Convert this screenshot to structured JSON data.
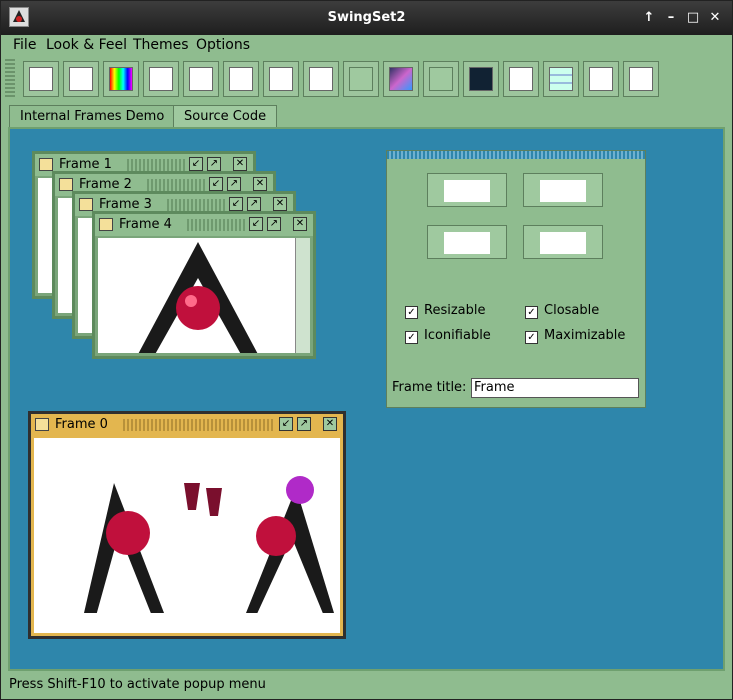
{
  "window": {
    "title": "SwingSet2"
  },
  "titlebar_buttons": [
    "↑",
    "–",
    "□",
    "✕"
  ],
  "menu": [
    {
      "label": "File"
    },
    {
      "label": "Look & Feel"
    },
    {
      "label": "Themes"
    },
    {
      "label": "Options"
    }
  ],
  "toolbar_icons": [
    "internal-frame-icon",
    "button-icon",
    "color-chooser-icon",
    "combobox-icon",
    "filechooser-icon",
    "html-icon",
    "list-icon",
    "optionpane-icon",
    "progressbar-icon",
    "scrollpane-icon",
    "slider-icon",
    "splitpane-icon",
    "tabbedpane-icon",
    "table-icon",
    "tooltip-icon",
    "tree-icon"
  ],
  "tabs": [
    {
      "label": "Internal Frames Demo",
      "active": true
    },
    {
      "label": "Source Code",
      "active": false
    }
  ],
  "frames": [
    {
      "title": "Frame 1"
    },
    {
      "title": "Frame 2"
    },
    {
      "title": "Frame 3"
    },
    {
      "title": "Frame 4"
    },
    {
      "title": "Frame 0"
    }
  ],
  "panel": {
    "checkboxes": [
      {
        "label": "Resizable",
        "checked": true
      },
      {
        "label": "Closable",
        "checked": true
      },
      {
        "label": "Iconifiable",
        "checked": true
      },
      {
        "label": "Maximizable",
        "checked": true
      }
    ],
    "frame_title_label": "Frame title:",
    "frame_title_value": "Frame"
  },
  "status": "Press Shift-F10 to activate popup menu",
  "colors": {
    "background": "#8fbc8f",
    "desktop": "#2e86ab",
    "active_frame": "#e3b64f"
  }
}
